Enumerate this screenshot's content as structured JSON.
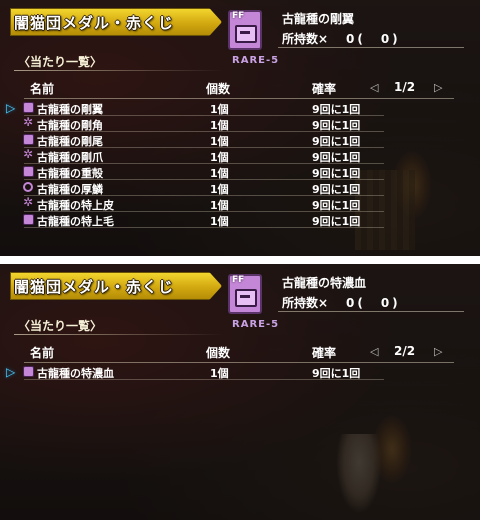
{
  "colors": {
    "banner_gold": "#e0bb1c",
    "cursor_cyan": "#4ad2ff",
    "rarity_purple": "#c9a2e4",
    "icon_purple": "#c486d6"
  },
  "screens": [
    {
      "banner": "闇猫団メダル・赤くじ",
      "subheader": "〈当たり一覧〉",
      "item_icon": {
        "badge": "FF",
        "icon": "medal-icon",
        "rarity": "RARE-5"
      },
      "selected_item": {
        "name": "古龍種の剛翼",
        "owned_label": "所持数×",
        "owned_value": "0(　0)"
      },
      "columns": {
        "name": "名前",
        "qty": "個数",
        "rate": "確率"
      },
      "pager": {
        "left": "◁",
        "right": "▷",
        "page": "1/2"
      },
      "cursor": "▷",
      "rows": [
        {
          "icon": "medal-icon",
          "name": "古龍種の剛翼",
          "qty": "1個",
          "rate": "9回に1回"
        },
        {
          "icon": "claw-icon",
          "name": "古龍種の剛角",
          "qty": "1個",
          "rate": "9回に1回"
        },
        {
          "icon": "medal-icon",
          "name": "古龍種の剛尾",
          "qty": "1個",
          "rate": "9回に1回"
        },
        {
          "icon": "claw-icon",
          "name": "古龍種の剛爪",
          "qty": "1個",
          "rate": "9回に1回"
        },
        {
          "icon": "medal-icon",
          "name": "古龍種の重殻",
          "qty": "1個",
          "rate": "9回に1回"
        },
        {
          "icon": "scale-icon",
          "name": "古龍種の厚鱗",
          "qty": "1個",
          "rate": "9回に1回"
        },
        {
          "icon": "claw-icon",
          "name": "古龍種の特上皮",
          "qty": "1個",
          "rate": "9回に1回"
        },
        {
          "icon": "medal-icon",
          "name": "古龍種の特上毛",
          "qty": "1個",
          "rate": "9回に1回"
        }
      ]
    },
    {
      "banner": "闇猫団メダル・赤くじ",
      "subheader": "〈当たり一覧〉",
      "item_icon": {
        "badge": "FF",
        "icon": "medal-icon",
        "rarity": "RARE-5"
      },
      "selected_item": {
        "name": "古龍種の特濃血",
        "owned_label": "所持数×",
        "owned_value": "0(　0)"
      },
      "columns": {
        "name": "名前",
        "qty": "個数",
        "rate": "確率"
      },
      "pager": {
        "left": "◁",
        "right": "▷",
        "page": "2/2"
      },
      "cursor": "▷",
      "rows": [
        {
          "icon": "medal-icon",
          "name": "古龍種の特濃血",
          "qty": "1個",
          "rate": "9回に1回"
        }
      ]
    }
  ]
}
